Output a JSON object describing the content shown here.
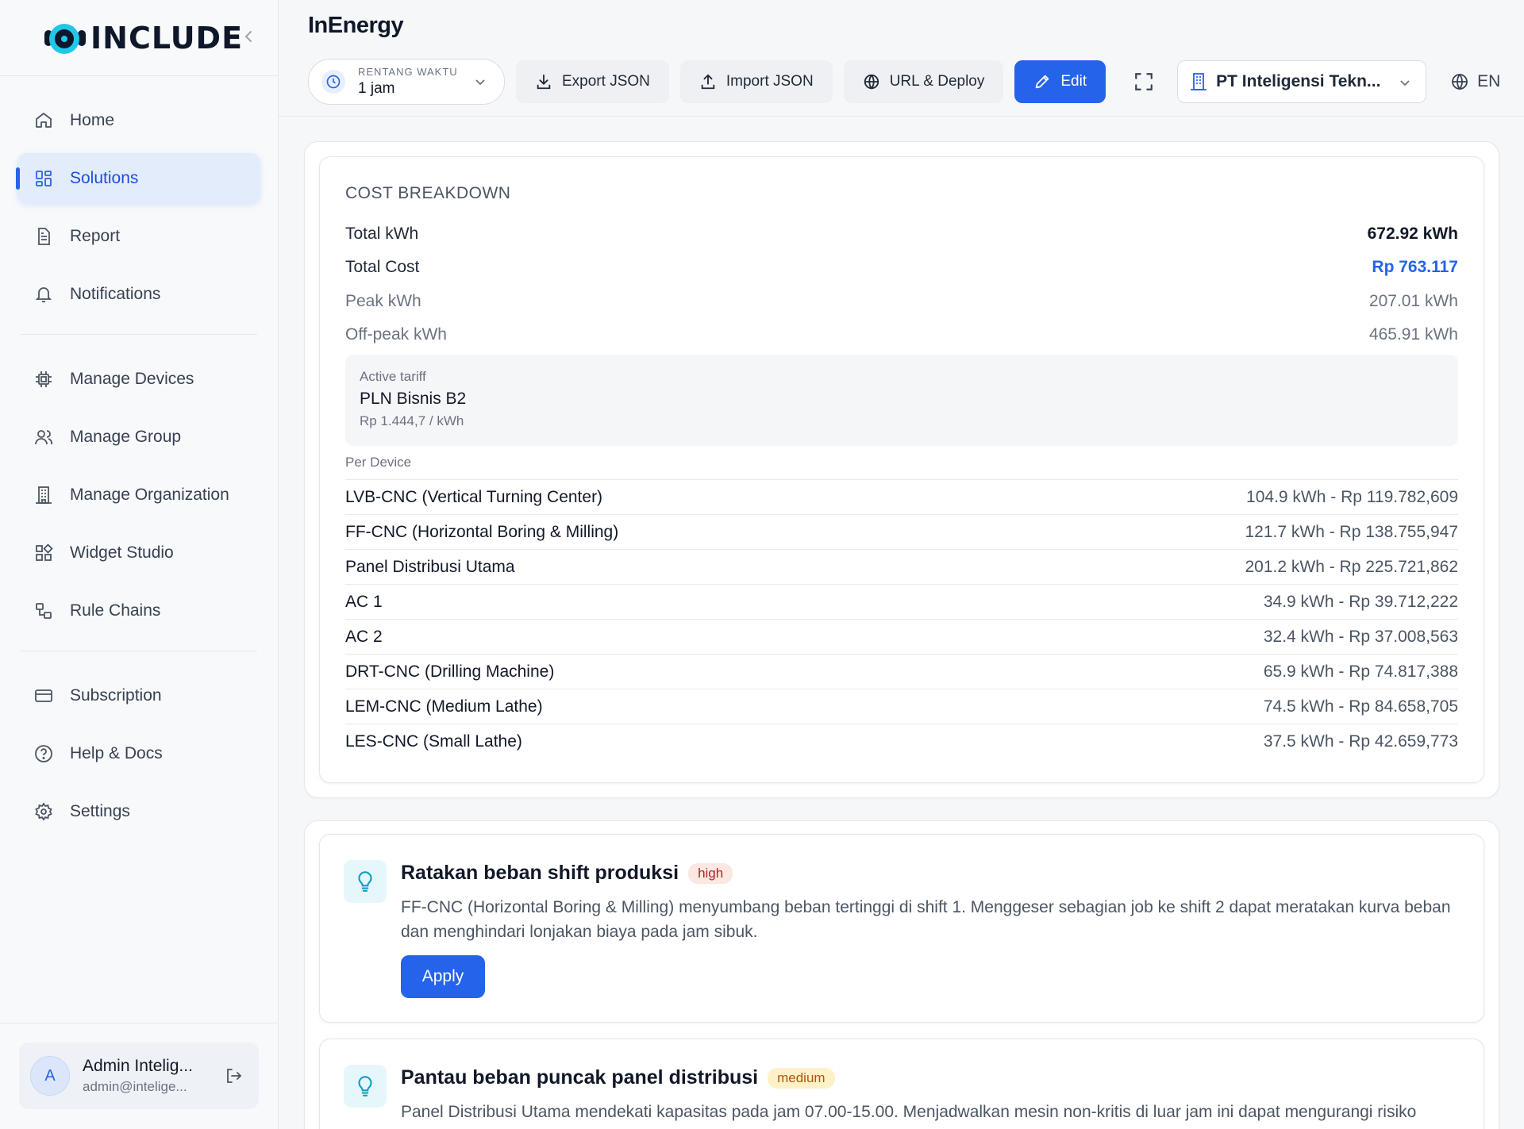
{
  "brand": {
    "name": "INCLUDE"
  },
  "sidebar": {
    "items": [
      {
        "label": "Home",
        "icon": "home-icon"
      },
      {
        "label": "Solutions",
        "icon": "grid-icon",
        "active": true
      },
      {
        "label": "Report",
        "icon": "document-icon"
      },
      {
        "label": "Notifications",
        "icon": "bell-icon"
      },
      {
        "label": "Manage Devices",
        "icon": "chip-icon"
      },
      {
        "label": "Manage Group",
        "icon": "users-icon"
      },
      {
        "label": "Manage Organization",
        "icon": "building-icon"
      },
      {
        "label": "Widget Studio",
        "icon": "widgets-icon"
      },
      {
        "label": "Rule Chains",
        "icon": "nodes-icon"
      },
      {
        "label": "Subscription",
        "icon": "card-icon"
      },
      {
        "label": "Help & Docs",
        "icon": "help-icon"
      },
      {
        "label": "Settings",
        "icon": "gear-icon"
      }
    ],
    "user": {
      "initial": "A",
      "name": "Admin Intelig...",
      "email": "admin@intelige..."
    }
  },
  "header": {
    "title": "InEnergy",
    "time_range": {
      "label": "RENTANG WAKTU",
      "value": "1 jam"
    },
    "buttons": {
      "export": "Export JSON",
      "import": "Import JSON",
      "deploy": "URL & Deploy",
      "edit": "Edit"
    },
    "organization": "PT Inteligensi Tekn...",
    "language": "EN"
  },
  "cost_breakdown": {
    "title": "COST BREAKDOWN",
    "summary": [
      {
        "label": "Total kWh",
        "value": "672.92 kWh"
      },
      {
        "label": "Total Cost",
        "value": "Rp 763.117"
      },
      {
        "label": "Peak kWh",
        "value": "207.01 kWh"
      },
      {
        "label": "Off-peak kWh",
        "value": "465.91 kWh"
      }
    ],
    "tariff": {
      "label": "Active tariff",
      "name": "PLN Bisnis B2",
      "rate": "Rp 1.444,7 / kWh"
    },
    "per_device_label": "Per Device",
    "devices": [
      {
        "name": "LVB-CNC (Vertical Turning Center)",
        "value": "104.9 kWh - Rp 119.782,609"
      },
      {
        "name": "FF-CNC (Horizontal Boring & Milling)",
        "value": "121.7 kWh - Rp 138.755,947"
      },
      {
        "name": "Panel Distribusi Utama",
        "value": "201.2 kWh - Rp 225.721,862"
      },
      {
        "name": "AC 1",
        "value": "34.9 kWh - Rp 39.712,222"
      },
      {
        "name": "AC 2",
        "value": "32.4 kWh - Rp 37.008,563"
      },
      {
        "name": "DRT-CNC (Drilling Machine)",
        "value": "65.9 kWh - Rp 74.817,388"
      },
      {
        "name": "LEM-CNC (Medium Lathe)",
        "value": "74.5 kWh - Rp 84.658,705"
      },
      {
        "name": "LES-CNC (Small Lathe)",
        "value": "37.5 kWh - Rp 42.659,773"
      }
    ]
  },
  "recommendations": [
    {
      "title": "Ratakan beban shift produksi",
      "priority": "high",
      "description": "FF-CNC (Horizontal Boring & Milling) menyumbang beban tertinggi di shift 1. Menggeser sebagian job ke shift 2 dapat meratakan kurva beban dan menghindari lonjakan biaya pada jam sibuk.",
      "action": "Apply"
    },
    {
      "title": "Pantau beban puncak panel distribusi",
      "priority": "medium",
      "description": "Panel Distribusi Utama mendekati kapasitas pada jam 07.00-15.00. Menjadwalkan mesin non-kritis di luar jam ini dapat mengurangi risiko"
    }
  ],
  "colors": {
    "accent": "#2563eb",
    "active_bg": "#e3ecfb",
    "brand_cyan": "#1ec8e8"
  }
}
